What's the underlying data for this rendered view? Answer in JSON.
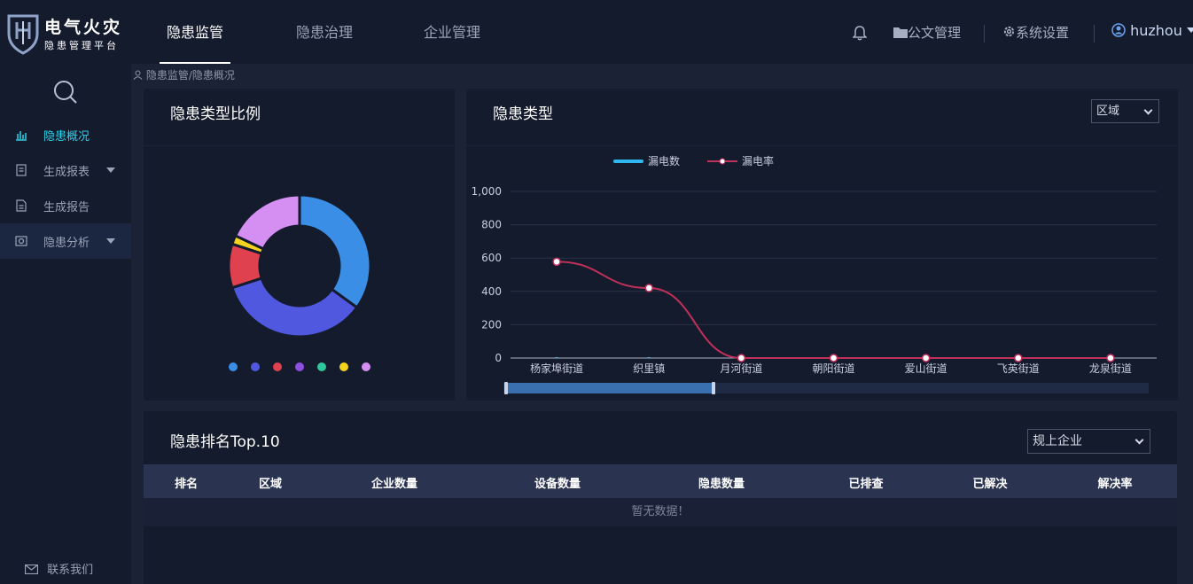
{
  "app": {
    "title": "电气火灾",
    "subtitle": "隐患管理平台"
  },
  "nav": {
    "tabs": [
      {
        "label": "隐患监管",
        "active": true
      },
      {
        "label": "隐患治理",
        "active": false
      },
      {
        "label": "企业管理",
        "active": false
      }
    ]
  },
  "topright": {
    "bell_icon": "bell-icon",
    "docs_label": "公文管理",
    "settings_label": "系统设置",
    "user_label": "huzhou"
  },
  "sidebar": {
    "items": [
      {
        "label": "隐患概况",
        "icon": "bar-chart-icon",
        "active": true,
        "has_caret": false
      },
      {
        "label": "生成报表",
        "icon": "report-icon",
        "active": false,
        "has_caret": true
      },
      {
        "label": "生成报告",
        "icon": "document-icon",
        "active": false,
        "has_caret": false
      },
      {
        "label": "隐患分析",
        "icon": "analysis-icon",
        "active": false,
        "has_caret": true
      }
    ],
    "contact_label": "联系我们"
  },
  "breadcrumb": "隐患监管/隐患概况",
  "donut_panel": {
    "title": "隐患类型比例",
    "colors": {
      "blue": "#3a8ee6",
      "indigo": "#5058e0",
      "red": "#e0414f",
      "purple": "#8f4fe0",
      "green": "#2fc79c",
      "yellow": "#f4d31f",
      "violet": "#d58ef2"
    }
  },
  "bar_panel": {
    "title": "隐患类型",
    "select_value": "区域",
    "colors": {
      "count": "#2fb8f0",
      "rate": "#c0305a"
    }
  },
  "chart_data": [
    {
      "type": "pie",
      "title": "隐患类型比例",
      "values": [
        35,
        35,
        10,
        0,
        0,
        2,
        18
      ],
      "colors": [
        "#3a8ee6",
        "#5058e0",
        "#e0414f",
        "#8f4fe0",
        "#2fc79c",
        "#f4d31f",
        "#d58ef2"
      ],
      "legend": "bottom"
    },
    {
      "type": "line",
      "title": "隐患类型",
      "categories": [
        "杨家埠街道",
        "织里镇",
        "月河街道",
        "朝阳街道",
        "爱山街道",
        "飞英街道",
        "龙泉街道"
      ],
      "series": [
        {
          "name": "漏电数",
          "type": "bar",
          "values": [
            0,
            0,
            0,
            0,
            0,
            0,
            0
          ]
        },
        {
          "name": "漏电率",
          "type": "line",
          "values": [
            578,
            420,
            0,
            0,
            0,
            0,
            0
          ]
        }
      ],
      "ylim": [
        0,
        1000
      ],
      "yticks": [
        "0",
        "200",
        "400",
        "600",
        "800",
        "1,000"
      ],
      "grid": true,
      "legend": "top"
    }
  ],
  "ranking": {
    "title": "隐患排名Top.10",
    "select_value": "规上企业",
    "columns": [
      "排名",
      "区域",
      "企业数量",
      "设备数量",
      "隐患数量",
      "已排查",
      "已解决",
      "解决率"
    ],
    "empty_text": "暂无数据！"
  }
}
